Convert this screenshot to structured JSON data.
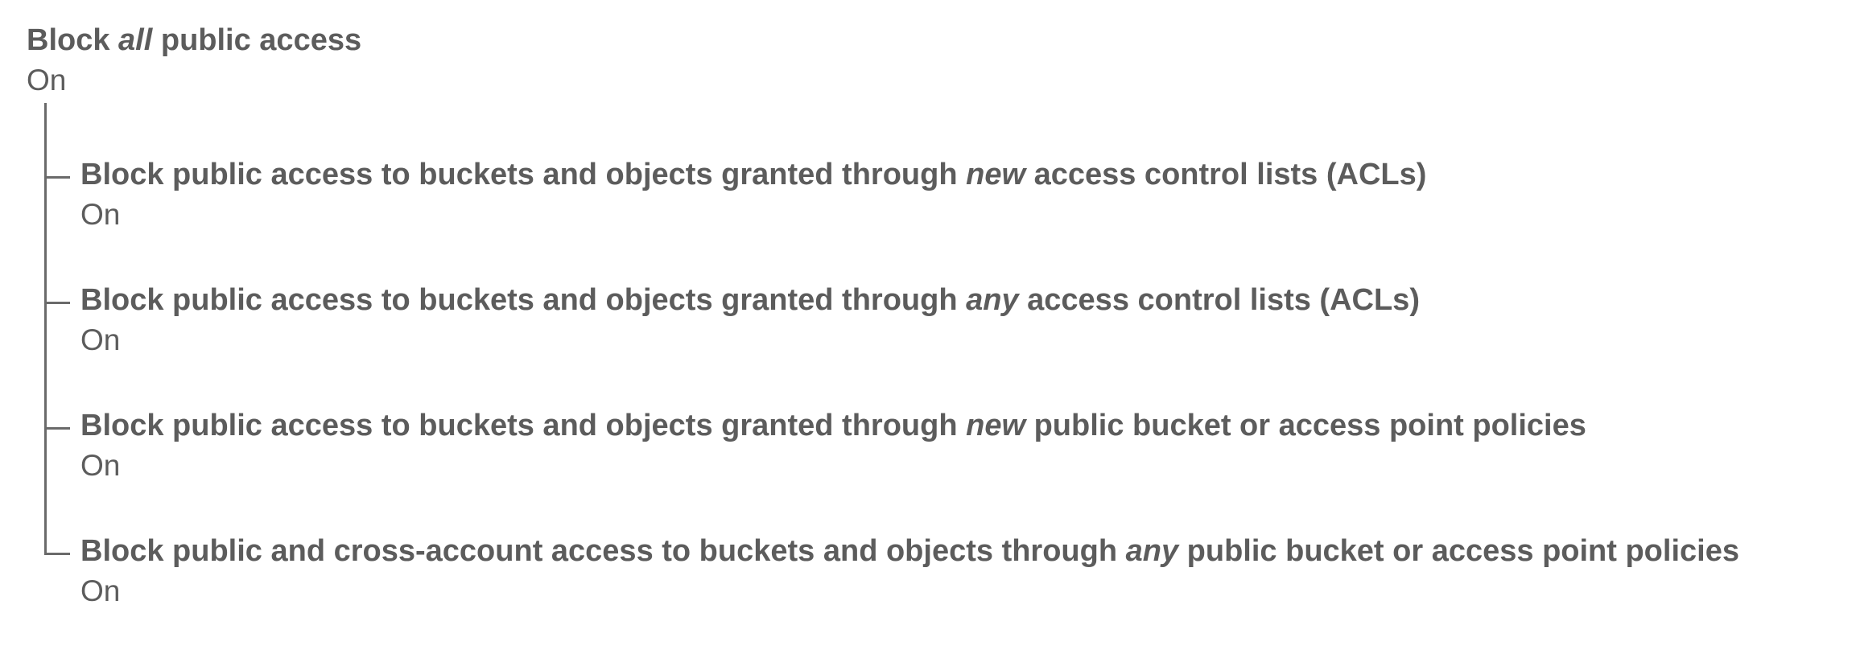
{
  "block_all": {
    "title_pre": "Block ",
    "title_em": "all",
    "title_post": " public access",
    "status": "On"
  },
  "settings": [
    {
      "title_pre": "Block public access to buckets and objects granted through ",
      "title_em": "new",
      "title_post": " access control lists (ACLs)",
      "status": "On"
    },
    {
      "title_pre": "Block public access to buckets and objects granted through ",
      "title_em": "any",
      "title_post": " access control lists (ACLs)",
      "status": "On"
    },
    {
      "title_pre": "Block public access to buckets and objects granted through ",
      "title_em": "new",
      "title_post": " public bucket or access point policies",
      "status": "On"
    },
    {
      "title_pre": "Block public and cross-account access to buckets and objects through ",
      "title_em": "any",
      "title_post": " public bucket or access point policies",
      "status": "On"
    }
  ]
}
